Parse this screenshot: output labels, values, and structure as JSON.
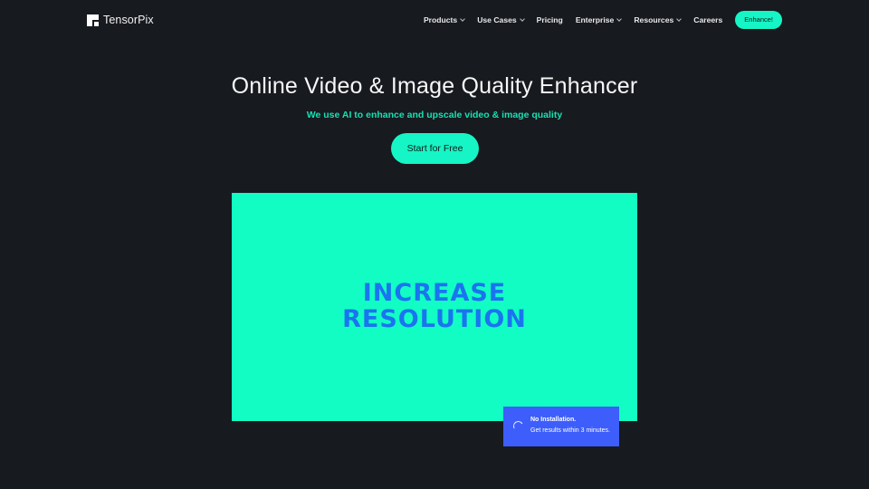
{
  "brand": {
    "name": "TensorPix",
    "accent": "#16f5c5",
    "background": "#171a1f"
  },
  "nav": {
    "items": [
      {
        "label": "Products",
        "has_dropdown": true
      },
      {
        "label": "Use Cases",
        "has_dropdown": true
      },
      {
        "label": "Pricing",
        "has_dropdown": false
      },
      {
        "label": "Enterprise",
        "has_dropdown": true
      },
      {
        "label": "Resources",
        "has_dropdown": true
      },
      {
        "label": "Careers",
        "has_dropdown": false
      }
    ],
    "cta_label": "Enhance!"
  },
  "hero": {
    "title": "Online Video & Image Quality Enhancer",
    "subtitle": "We use AI to enhance and upscale video & image quality",
    "cta_label": "Start for Free"
  },
  "demo": {
    "line1": "INCREASE",
    "line2": "RESOLUTION",
    "background_color": "#12fdc4",
    "text_color": "#1a74f0"
  },
  "toast": {
    "icon": "spinner-icon",
    "line1": "No Installation.",
    "line2": "Get results within 3 minutes.",
    "color": "#3d5efb"
  }
}
